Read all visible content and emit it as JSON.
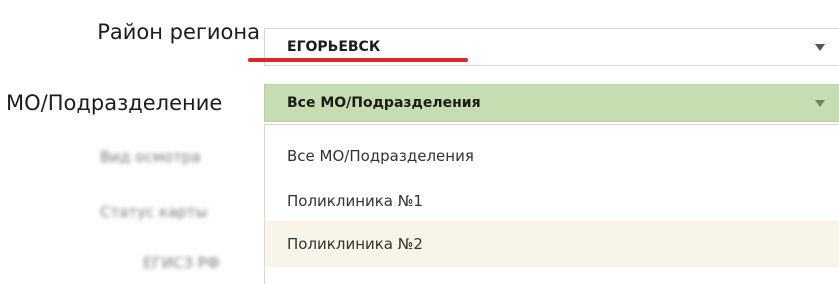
{
  "form": {
    "district_label": "Район региона",
    "district_value": "ЕГОРЬЕВСК",
    "mo_label": "МО/Подразделение",
    "mo_value": "Все МО/Подразделения"
  },
  "blurred_labels": [
    "Вид осмотра",
    "Статус карты",
    "ЕГИСЗ РФ"
  ],
  "dropdown": {
    "options": [
      "Все МО/Подразделения",
      "Поликлиника №1",
      "Поликлиника №2"
    ],
    "hovered_index": 2
  },
  "colors": {
    "active_select_bg": "#c6ddb1",
    "underline": "#d42a2a",
    "hover_bg": "#f8f4e8"
  },
  "icons": {
    "district_arrow": "chevron-down-icon",
    "mo_arrow": "chevron-down-icon"
  }
}
